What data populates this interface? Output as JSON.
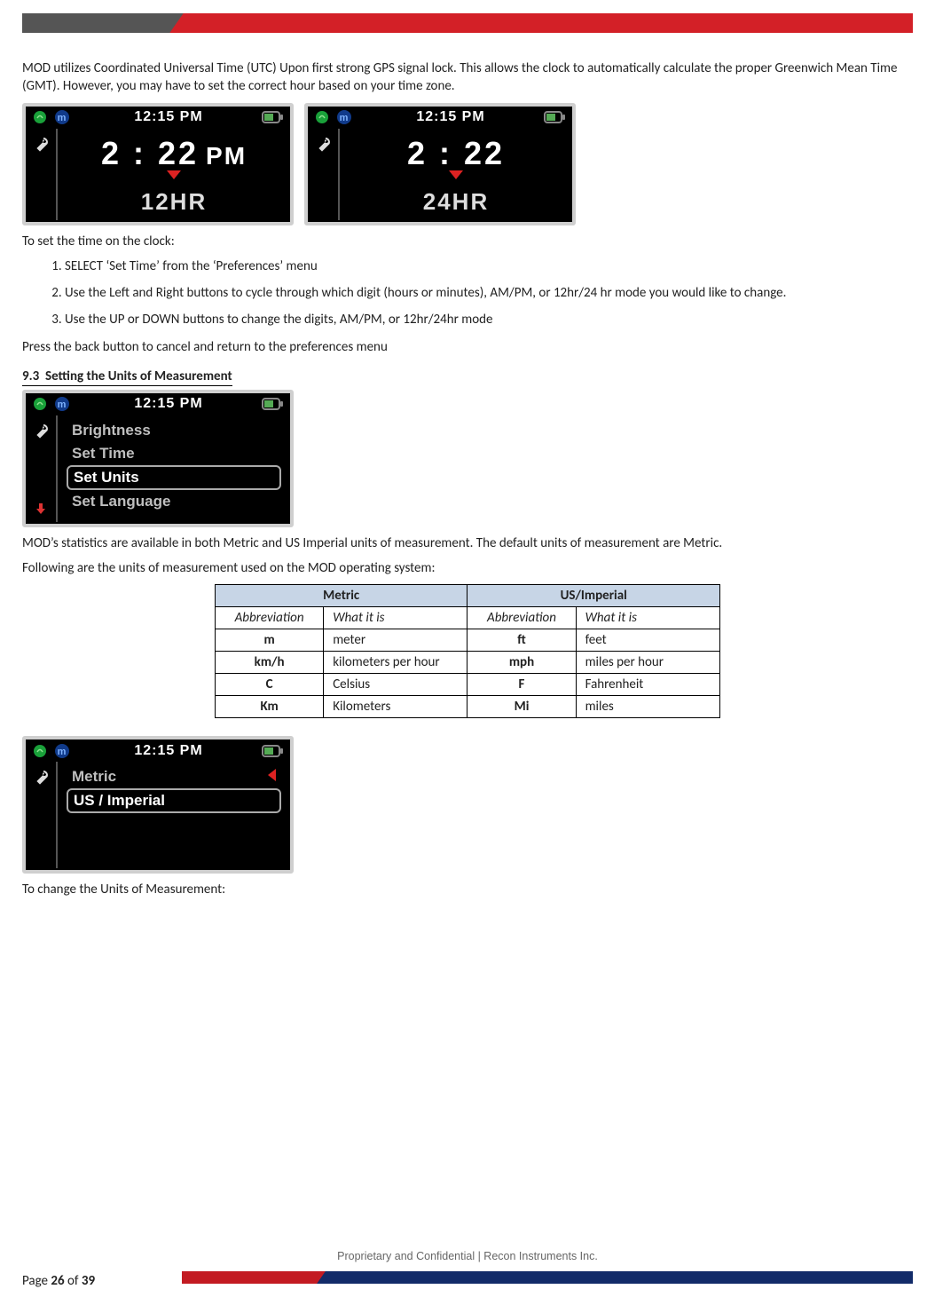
{
  "header": {},
  "body": {
    "p1": "MOD utilizes Coordinated Universal Time (UTC) Upon first strong GPS signal lock. This allows the clock to automatically calculate the proper Greenwich Mean Time (GMT). However, you may have to set the correct hour based on your time zone.",
    "dev_time_header": "12:15 PM",
    "dev_clock_12": "2 : 22",
    "dev_clock_12_ampm": "PM",
    "dev_mode_12": "12HR",
    "dev_clock_24": "2 : 22",
    "dev_mode_24": "24HR",
    "p_set_time_intro": "To set the time on the clock:",
    "ol1": [
      "SELECT ‘Set Time’ from the ‘Preferences’ menu",
      "Use the Left and Right buttons to cycle through which digit (hours or minutes), AM/PM, or 12hr/24 hr mode you would like to change.",
      "Use the UP or DOWN buttons to change the digits, AM/PM, or 12hr/24hr mode"
    ],
    "p_back": "Press the back button to cancel and return to the preferences menu",
    "section_93_num": "9.3",
    "section_93_title": "Setting the Units of Measurement",
    "prefs_menu": [
      "Brightness",
      "Set Time",
      "Set Units",
      "Set Language"
    ],
    "prefs_selected_index": 2,
    "p_units1": "MOD’s statistics are available in both Metric and US Imperial units of measurement. The default units of measurement are Metric.",
    "p_units2": "Following are the units of measurement used on the MOD operating system:",
    "table": {
      "head": [
        "Metric",
        "US/Imperial"
      ],
      "sub": [
        "Abbreviation",
        "What it is",
        "Abbreviation",
        "What it is"
      ],
      "rows": [
        [
          "m",
          "meter",
          "ft",
          "feet"
        ],
        [
          "km/h",
          "kilometers per hour",
          "mph",
          "miles per hour"
        ],
        [
          "C",
          "Celsius",
          "F",
          "Fahrenheit"
        ],
        [
          "Km",
          "Kilometers",
          "Mi",
          "miles"
        ]
      ]
    },
    "units_menu": [
      "Metric",
      "US / Imperial"
    ],
    "units_selected_index": 1,
    "p_change_units": "To change the Units of Measurement:"
  },
  "footer": {
    "center": "Proprietary and Confidential  |  Recon Instruments Inc.",
    "page_prefix": "Page ",
    "page_cur": "26",
    "page_of": " of ",
    "page_total": "39"
  },
  "icons": {
    "gps": "gps-icon",
    "menu_m": "menu-m-icon",
    "battery": "battery-icon",
    "wrench": "wrench-icon",
    "arrow_down": "arrow-down-icon",
    "left_nav": "left-nav-icon"
  }
}
